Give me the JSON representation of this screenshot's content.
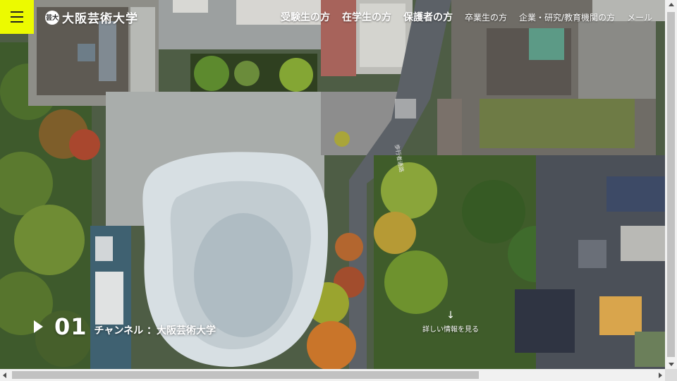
{
  "header": {
    "logo_mark": "芸大",
    "logo_text": "大阪芸術大学",
    "nav_major": [
      "受験生の方",
      "在学生の方",
      "保護者の方"
    ],
    "nav_minor": [
      "卒業生の方",
      "企業・研究/教育機関の方",
      "メール"
    ]
  },
  "hero": {
    "channel_number": "01",
    "channel_label": "チャンネル ：大阪芸術大学",
    "more_label": "詳しい情報を見る",
    "road_text": "歩行者通路"
  },
  "colors": {
    "menu_accent": "#ecfa00"
  }
}
